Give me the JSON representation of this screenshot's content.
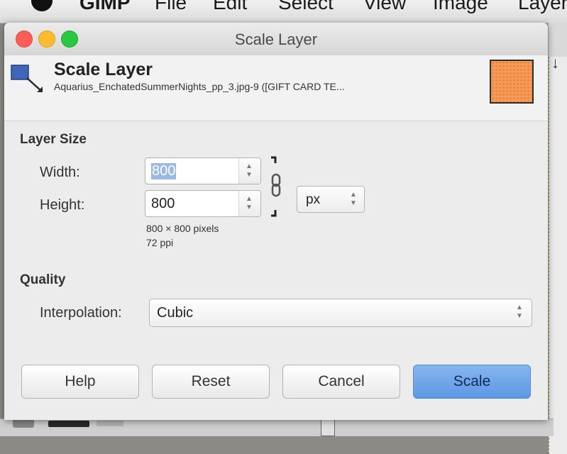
{
  "menubar": {
    "items": [
      "GIMP",
      "File",
      "Edit",
      "Select",
      "View",
      "Image",
      "Layer"
    ]
  },
  "dialog": {
    "window_title": "Scale Layer",
    "header": {
      "title": "Scale Layer",
      "subtitle": "Aquarius_EnchatedSummerNights_pp_3.jpg-9 ([GIFT CARD TE..."
    },
    "layer_size": {
      "section_label": "Layer Size",
      "width_label": "Width:",
      "width_value": "800",
      "height_label": "Height:",
      "height_value": "800",
      "unit": "px",
      "pixels_info": "800 × 800 pixels",
      "resolution_info": "72 ppi"
    },
    "quality": {
      "section_label": "Quality",
      "interpolation_label": "Interpolation:",
      "interpolation_value": "Cubic"
    },
    "buttons": {
      "help": "Help",
      "reset": "Reset",
      "cancel": "Cancel",
      "scale": "Scale"
    }
  },
  "colors": {
    "primary_button": "#5d98e3",
    "selection": "#9ab8e3",
    "thumbnail": "#f59b55"
  },
  "icons": [
    "apple-icon",
    "scale-layer-icon",
    "chain-link-icon",
    "stepper-arrows-icon",
    "close-icon",
    "minimize-icon",
    "zoom-icon"
  ]
}
